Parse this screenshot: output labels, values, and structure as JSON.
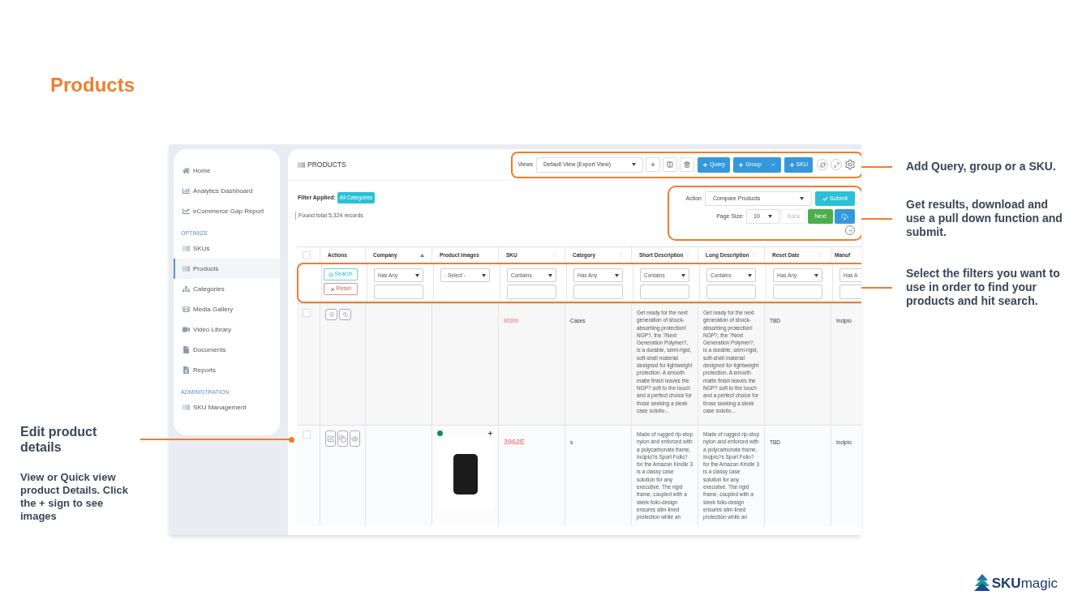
{
  "page_title": "Products",
  "sidebar": {
    "groups": [
      {
        "items": [
          {
            "label": "Home",
            "selected": false
          },
          {
            "label": "Analytics Dashboard",
            "selected": false
          },
          {
            "label": "eCommerce Gap Report",
            "selected": false
          }
        ]
      },
      {
        "heading": "OPTIMIZE",
        "items": [
          {
            "label": "SKUs",
            "selected": false
          },
          {
            "label": "Products",
            "selected": true
          },
          {
            "label": "Categories",
            "selected": false
          },
          {
            "label": "Media Gallery",
            "selected": false
          },
          {
            "label": "Video Library",
            "selected": false
          },
          {
            "label": "Documents",
            "selected": false
          },
          {
            "label": "Reports",
            "selected": false
          }
        ]
      },
      {
        "heading": "ADMINISTRATION",
        "items": [
          {
            "label": "SKU Management",
            "selected": false
          }
        ]
      }
    ]
  },
  "panel": {
    "title": "PRODUCTS",
    "views_label": "Views",
    "view_select": "Default View (Export View)",
    "add_buttons": [
      {
        "label": "Query",
        "dropdown": false
      },
      {
        "label": "Group",
        "dropdown": true
      },
      {
        "label": "SKU",
        "dropdown": false
      }
    ],
    "filter_label": "Filter Applied:",
    "filter_badge": "All Categories",
    "records": "Found total 5,324 records",
    "action_label": "Action",
    "action_select": "Compare Products",
    "submit": "Submit",
    "page_size_label": "Page Size:",
    "page_size": "10",
    "back": {
      "label": "Back",
      "disabled": true
    },
    "next": {
      "label": "Next",
      "disabled": false
    }
  },
  "table": {
    "select_all_checked": false,
    "columns": [
      {
        "label": "Actions",
        "sortable": false,
        "sorted": false
      },
      {
        "label": "Company",
        "sortable": true,
        "sorted": true
      },
      {
        "label": "Product Images",
        "sortable": false,
        "sorted": false
      },
      {
        "label": "SKU",
        "sortable": true,
        "sorted": false
      },
      {
        "label": "Category",
        "sortable": true,
        "sorted": false
      },
      {
        "label": "Short Description",
        "sortable": true,
        "sorted": false
      },
      {
        "label": "Long Description",
        "sortable": true,
        "sorted": false
      },
      {
        "label": "Reset Date",
        "sortable": true,
        "sorted": false
      },
      {
        "label": "Manuf",
        "sortable": false,
        "sorted": false
      }
    ],
    "filters": [
      {
        "kind": "buttons",
        "search": "Search",
        "reset": "Reset"
      },
      {
        "kind": "select",
        "value": "Has Any",
        "input": true
      },
      {
        "kind": "select",
        "value": "- Select -",
        "input": false
      },
      {
        "kind": "select",
        "value": "Contains",
        "input": true
      },
      {
        "kind": "select",
        "value": "Has Any",
        "input": true
      },
      {
        "kind": "select",
        "value": "Contains",
        "input": true
      },
      {
        "kind": "select",
        "value": "Contains",
        "input": true
      },
      {
        "kind": "select",
        "value": "Has Any",
        "input": true
      },
      {
        "kind": "select",
        "value": "Has A",
        "input": true
      }
    ],
    "rows": [
      {
        "checked": false,
        "actions": [
          {
            "kind": "edit"
          },
          {
            "kind": "copy"
          }
        ],
        "has_image": false,
        "sku": "90200",
        "category": "Cases",
        "short_description": "Get ready for the next generation of shock-absorbing protection! NGP?, the ?Next Generation Polymer?, is a durable, semi-rigid, soft-shell material designed for lightweight protection. A smooth matte finish leaves the NGP? soft to the touch and a perfect choice for those seeking a sleek case solutio...",
        "long_description": "Get ready for the next generation of shock-absorbing protection! NGP?, the ?Next Generation Polymer?, is a durable, semi-rigid, soft-shell material designed for lightweight protection. A smooth matte finish leaves the NGP? soft to the touch and a perfect choice for those seeking a sleek case solutio...",
        "reset_date": "TBD",
        "manufacturer": "Incipio"
      },
      {
        "checked": false,
        "actions": [
          {
            "kind": "edit"
          },
          {
            "kind": "copy"
          },
          {
            "kind": "view"
          }
        ],
        "has_image": true,
        "sku": "3962E",
        "category": "s",
        "short_description": "Made of rugged rip-stop nylon and enforced with a polycarbonate frame, Incipio?s Sport Folio? for the Amazon Kindle 3 is a classy case solution for any executive. The rigid frame, coupled with a sleek folio-design ensures slim-lined protection while an",
        "long_description": "Made of rugged rip-stop nylon and enforced with a polycarbonate frame, Incipio?s Sport Folio? for the Amazon Kindle 3 is a classy case solution for any executive. The rigid frame, coupled with a sleek folio-design ensures slim-lined protection while an",
        "reset_date": "TBD",
        "manufacturer": "Incipio"
      }
    ]
  },
  "annotations": {
    "right": [
      "Add Query, group or a SKU.",
      "Get results, download and use a pull down function and submit.",
      "Select the filters you want to use in order to find your products and hit search."
    ],
    "left_heading": "Edit product details",
    "left_body": "View or Quick view product Details. Click the + sign to see images"
  },
  "logo": "**SKU**magic"
}
